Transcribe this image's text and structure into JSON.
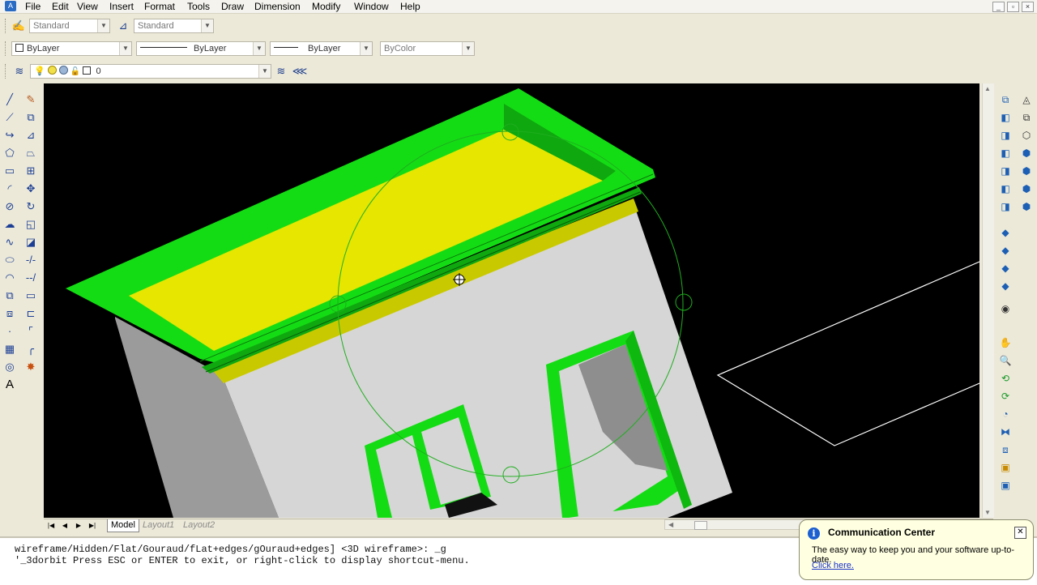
{
  "menu": {
    "items": [
      "File",
      "Edit",
      "View",
      "Insert",
      "Format",
      "Tools",
      "Draw",
      "Dimension",
      "Modify",
      "Window",
      "Help"
    ]
  },
  "window_controls": {
    "minimize": "_",
    "restore": "▫",
    "close": "×"
  },
  "styles_toolbar": {
    "text_style": "Standard",
    "dim_style": "Standard"
  },
  "properties_toolbar": {
    "color": "ByLayer",
    "linetype": "ByLayer",
    "lineweight": "ByLayer",
    "plotstyle": "ByColor"
  },
  "layers_toolbar": {
    "current_layer": "0"
  },
  "tabs": {
    "model": "Model",
    "layout1": "Layout1",
    "layout2": "Layout2"
  },
  "command_line": {
    "line1": "wireframe/Hidden/Flat/Gouraud/fLat+edges/gOuraud+edges] <3D wireframe>: _g",
    "line2": "'_3dorbit Press ESC or ENTER to exit, or right-click to display shortcut-menu."
  },
  "communication_center": {
    "title": "Communication Center",
    "message": "The easy way to keep you and your software up-to-date.",
    "link": "Click here."
  },
  "colors": {
    "viewport_bg": "#000000",
    "trim_green": "#14dc14",
    "roof_yellow": "#e6e600",
    "wall_light": "#d7d7d7",
    "wall_shadow": "#9a9a9a",
    "orbit_circle": "#1fae1f"
  }
}
